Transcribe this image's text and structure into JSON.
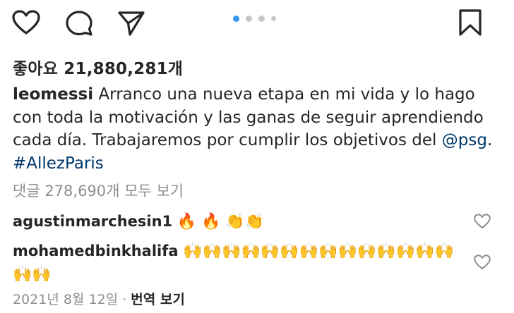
{
  "actions": {
    "like_icon": "heart-icon",
    "comment_icon": "comment-icon",
    "share_icon": "send-icon",
    "save_icon": "bookmark-icon"
  },
  "carousel": {
    "total": 4,
    "active_index": 0,
    "accent": "#3897f0"
  },
  "likes_text": "좋아요 21,880,281개",
  "caption": {
    "username": "leomessi",
    "text": "Arranco una nueva etapa en mi vida y lo hago con toda la motivación y las ganas de seguir aprendiendo cada día. Trabajaremos por cumplir los objetivos del",
    "mention": "@psg",
    "separator": ".",
    "hashtag": "#AllezParis"
  },
  "view_all_comments": "댓글 278,690개 모두 보기",
  "comments": [
    {
      "username": "agustinmarchesin1",
      "emojis": [
        "🔥",
        "🔥",
        "👏",
        "👏"
      ]
    },
    {
      "username": "mohamedbinkhalifa",
      "emojis": [
        "🙌",
        "🙌",
        "🙌",
        "🙌",
        "🙌",
        "🙌",
        "🙌",
        "🙌",
        "🙌",
        "🙌",
        "🙌",
        "🙌",
        "🙌",
        "🙌",
        "🙌",
        "🙌"
      ]
    }
  ],
  "footer": {
    "date": "2021년 8월 12일",
    "separator": "·",
    "translate": "번역 보기"
  },
  "colors": {
    "text": "#262626",
    "secondary": "#8e8e8e",
    "link": "#00376b"
  }
}
